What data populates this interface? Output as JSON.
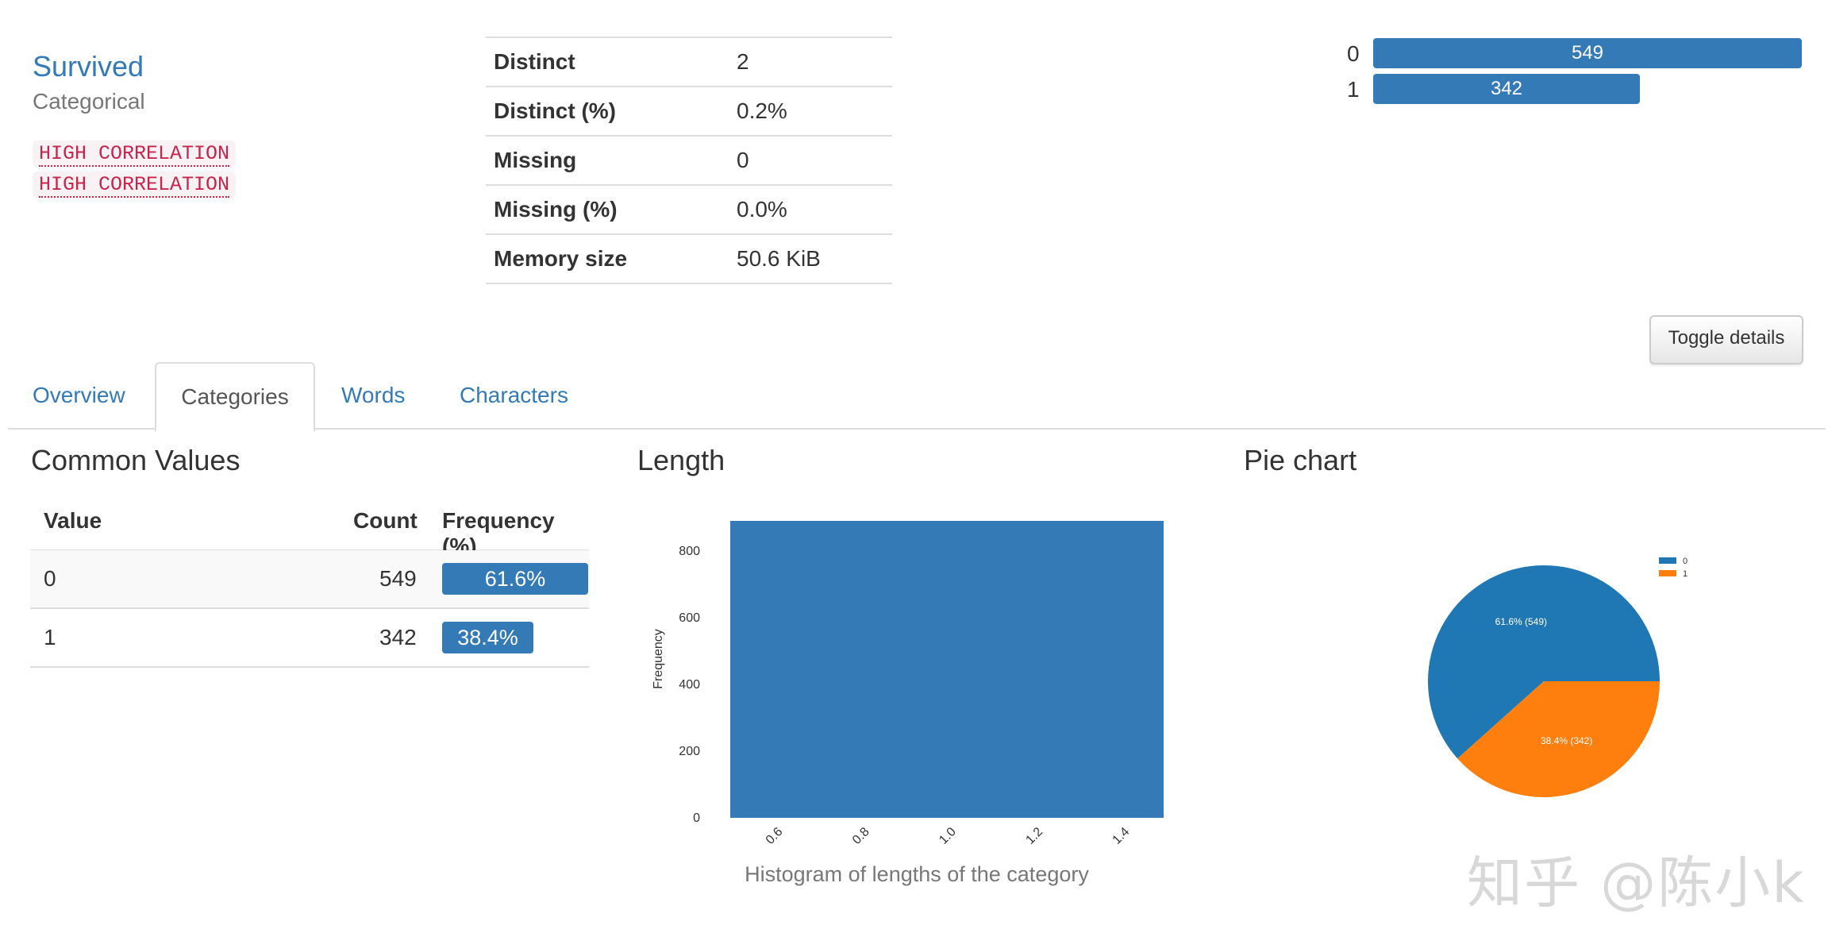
{
  "variable": {
    "name": "Survived",
    "type": "Categorical",
    "alerts": [
      "HIGH CORRELATION",
      "HIGH CORRELATION"
    ]
  },
  "stats": [
    {
      "label": "Distinct",
      "value": "2"
    },
    {
      "label": "Distinct (%)",
      "value": "0.2%"
    },
    {
      "label": "Missing",
      "value": "0"
    },
    {
      "label": "Missing (%)",
      "value": "0.0%"
    },
    {
      "label": "Memory size",
      "value": "50.6 KiB"
    }
  ],
  "mini_bars": [
    {
      "label": "0",
      "value": "549",
      "fraction": 1.0
    },
    {
      "label": "1",
      "value": "342",
      "fraction": 0.623
    }
  ],
  "toggle_label": "Toggle details",
  "tabs": [
    {
      "label": "Overview",
      "active": false
    },
    {
      "label": "Categories",
      "active": true
    },
    {
      "label": "Words",
      "active": false
    },
    {
      "label": "Characters",
      "active": false
    }
  ],
  "sections": {
    "common_values": "Common Values",
    "length": "Length",
    "pie": "Pie chart"
  },
  "common_values": {
    "headers": {
      "value": "Value",
      "count": "Count",
      "frequency": "Frequency (%)"
    },
    "rows": [
      {
        "value": "0",
        "count": "549",
        "frequency": "61.6%",
        "fraction": 0.616
      },
      {
        "value": "1",
        "count": "342",
        "frequency": "38.4%",
        "fraction": 0.384
      }
    ]
  },
  "chart_data": [
    {
      "type": "bar",
      "title": "",
      "caption": "Histogram of lengths of the category",
      "ylabel": "Frequency",
      "xlabel": "",
      "x_ticks": [
        "0.6",
        "0.8",
        "1.0",
        "1.2",
        "1.4"
      ],
      "y_ticks": [
        "0",
        "200",
        "400",
        "600",
        "800"
      ],
      "xlim": [
        0.5,
        1.5
      ],
      "ylim": [
        0,
        891
      ],
      "bins": [
        {
          "x0": 0.5,
          "x1": 1.5,
          "count": 891
        }
      ],
      "color": "#337ab7"
    },
    {
      "type": "pie",
      "legend": [
        "0",
        "1"
      ],
      "legend_position": "top-right",
      "slices": [
        {
          "label": "0",
          "value": 549,
          "text": "61.6%  (549)",
          "color": "#1f77b4"
        },
        {
          "label": "1",
          "value": 342,
          "text": "38.4%  (342)",
          "color": "#ff7f0e"
        }
      ]
    }
  ],
  "watermark": "知乎 @陈小k",
  "colors": {
    "primary": "#337ab7",
    "alert_text": "#c7254e",
    "alert_bg": "#f9f2f4"
  }
}
